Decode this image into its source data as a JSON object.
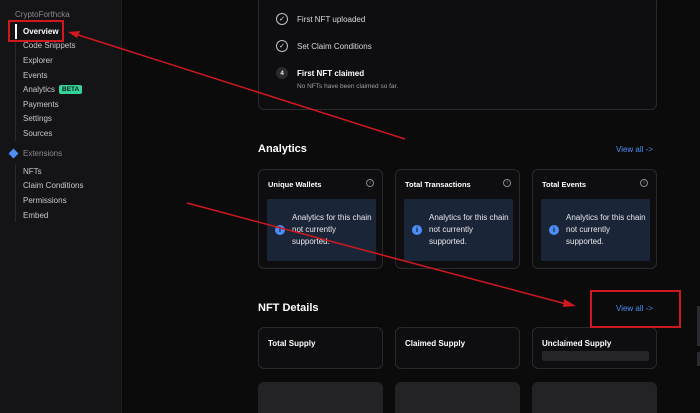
{
  "sidebar": {
    "contract_name": "CryptoForthcka",
    "items": [
      {
        "label": "Overview",
        "active": true
      },
      {
        "label": "Code Snippets"
      },
      {
        "label": "Explorer"
      },
      {
        "label": "Events"
      },
      {
        "label": "Analytics",
        "badge": "BETA"
      },
      {
        "label": "Payments"
      },
      {
        "label": "Settings"
      },
      {
        "label": "Sources"
      }
    ],
    "extensions_label": "Extensions",
    "extension_items": [
      {
        "label": "NFTs"
      },
      {
        "label": "Claim Conditions"
      },
      {
        "label": "Permissions"
      },
      {
        "label": "Embed"
      }
    ]
  },
  "checklist": {
    "steps": [
      {
        "label": "First NFT uploaded",
        "done": true
      },
      {
        "label": "Set Claim Conditions",
        "done": true
      },
      {
        "label": "First NFT claimed",
        "number": "4",
        "done": false
      }
    ],
    "note": "No NFTs have been claimed so far."
  },
  "analytics": {
    "title": "Analytics",
    "view_all": "View all ->",
    "cards": [
      {
        "title": "Unique Wallets",
        "message": "Analytics for this chain not currently supported."
      },
      {
        "title": "Total Transactions",
        "message": "Analytics for this chain not currently supported."
      },
      {
        "title": "Total Events",
        "message": "Analytics for this chain not currently supported."
      }
    ]
  },
  "nft_details": {
    "title": "NFT Details",
    "view_all": "View all ->",
    "cards": [
      {
        "title": "Total Supply"
      },
      {
        "title": "Claimed Supply"
      },
      {
        "title": "Unclaimed Supply"
      }
    ]
  },
  "icons": {
    "check": "check-circle-icon",
    "info": "info-icon",
    "extensions": "diamond-icon"
  },
  "colors": {
    "accent": "#4c8df6",
    "badge": "#34d399",
    "annotation": "#d0191f"
  }
}
